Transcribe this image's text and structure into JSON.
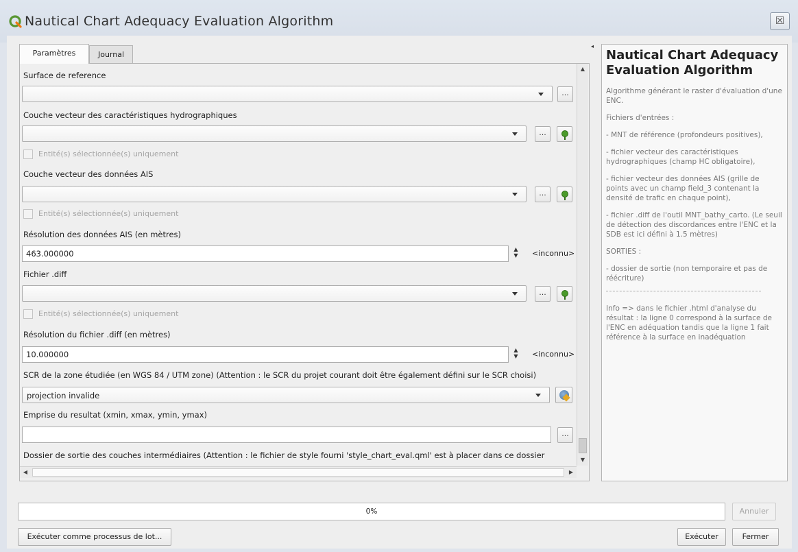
{
  "window": {
    "title": "Nautical Chart Adequacy Evaluation Algorithm",
    "close_glyph": "☒"
  },
  "tabs": [
    {
      "label": "Paramètres",
      "active": true
    },
    {
      "label": "Journal",
      "active": false
    }
  ],
  "params": {
    "surface_label": "Surface de reference",
    "surface_value": "",
    "hydro_label": "Couche vecteur des caractéristiques hydrographiques",
    "hydro_value": "",
    "hydro_selected_only": "Entité(s) sélectionnée(s) uniquement",
    "ais_label": "Couche vecteur des données AIS",
    "ais_value": "",
    "ais_selected_only": "Entité(s) sélectionnée(s) uniquement",
    "ais_resolution_label": "Résolution des données AIS (en mètres)",
    "ais_resolution_value": "463.000000",
    "ais_resolution_unit": "<inconnu>",
    "diff_label": "Fichier .diff",
    "diff_value": "",
    "diff_selected_only": "Entité(s) sélectionnée(s) uniquement",
    "diff_resolution_label": "Résolution du fichier .diff (en mètres)",
    "diff_resolution_value": "10.000000",
    "diff_resolution_unit": "<inconnu>",
    "crs_label": "SCR de la zone étudiée (en WGS 84 / UTM zone) (Attention : le SCR du projet courant doit être également défini sur le SCR choisi)",
    "crs_value": "projection invalide",
    "extent_label": "Emprise du resultat (xmin, xmax, ymin, ymax)",
    "extent_value": "",
    "output_label": "Dossier de sortie des couches intermédiaires (Attention : le fichier de style fourni 'style_chart_eval.qml' est à placer dans ce dossier",
    "browse_button": "..."
  },
  "help": {
    "title": "Nautical Chart Adequacy Evaluation Algorithm",
    "paragraphs": [
      "Algorithme générant le raster d'évaluation d'une ENC.",
      "Fichiers d'entrées :",
      "- MNT de référence (profondeurs positives),",
      "- fichier vecteur des caractéristiques hydrographiques (champ HC obligatoire),",
      "- fichier vecteur des données AIS (grille de points avec un champ field_3 contenant la densité de trafic en chaque point),",
      "- fichier .diff de l'outil MNT_bathy_carto. (Le seuil de détection des discordances entre l'ENC et la SDB est ici défini à 1.5 mètres)",
      "SORTIES :",
      "- dossier de sortie (non temporaire et pas de réécriture)",
      "Info => dans le fichier .html d'analyse du résultat : la ligne 0 correspond à la surface de l'ENC en adéquation tandis que la ligne 1 fait référence à la surface en inadéquation"
    ]
  },
  "footer": {
    "progress_text": "0%",
    "progress_value": 0,
    "cancel_button": "Annuler",
    "batch_button": "Exécuter comme processus de lot...",
    "run_button": "Exécuter",
    "close_button": "Fermer"
  },
  "icons": {
    "app_icon": "qgis-icon",
    "colors": {
      "qgis_green": "#589632",
      "qgis_yellow": "#ee7913"
    }
  }
}
